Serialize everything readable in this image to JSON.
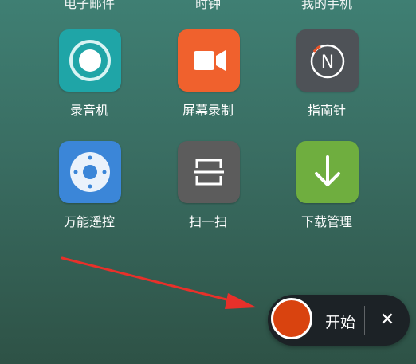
{
  "top_row": {
    "labels": [
      "电子邮件",
      "时钟",
      "我的手机"
    ]
  },
  "apps": [
    {
      "label": "录音机",
      "icon": "recorder-icon",
      "color": "#1fa5a7"
    },
    {
      "label": "屏幕录制",
      "icon": "video-camera-icon",
      "color": "#f0612d"
    },
    {
      "label": "指南针",
      "icon": "compass-icon",
      "color": "#4e5257"
    },
    {
      "label": "万能遥控",
      "icon": "remote-control-icon",
      "color": "#3b86d8"
    },
    {
      "label": "扫一扫",
      "icon": "scan-icon",
      "color": "#5c5c5c"
    },
    {
      "label": "下载管理",
      "icon": "download-icon",
      "color": "#6fae3f"
    }
  ],
  "compass_letter": "N",
  "recorder": {
    "start_label": "开始",
    "close_symbol": "✕",
    "button_color": "#d9430f"
  },
  "annotation": {
    "arrow_color": "#e8302a"
  }
}
